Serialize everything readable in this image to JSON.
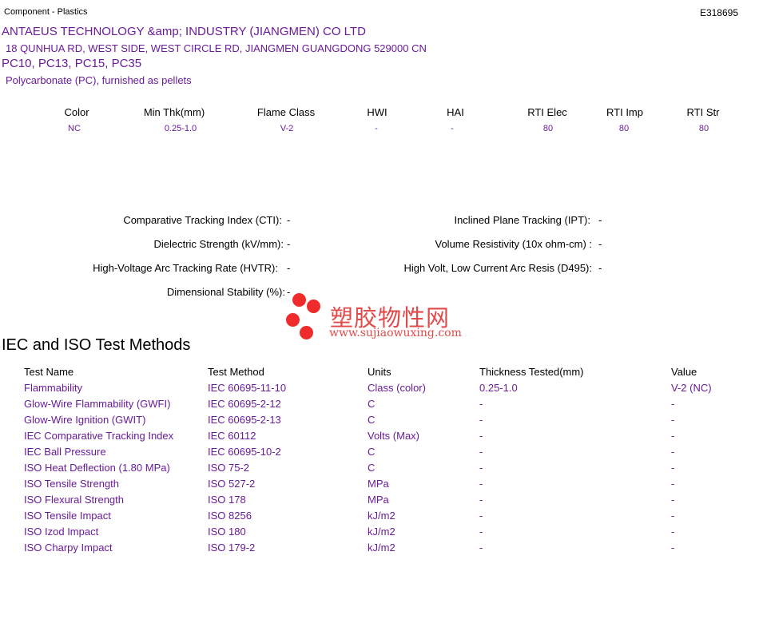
{
  "header": {
    "category": "Component - Plastics",
    "file_number": "E318695"
  },
  "company": {
    "name": "ANTAEUS TECHNOLOGY &amp; INDUSTRY (JIANGMEN) CO LTD",
    "address": "18 QUNHUA RD, WEST SIDE, WEST CIRCLE RD, JIANGMEN  GUANGDONG  529000 CN",
    "models": "PC10, PC13, PC15, PC35",
    "description": "Polycarbonate (PC), furnished as pellets"
  },
  "ratings": {
    "headers": [
      "Color",
      "Min Thk(mm)",
      "Flame Class",
      "HWI",
      "HAI",
      "RTI Elec",
      "RTI Imp",
      "RTI Str"
    ],
    "values": [
      "NC",
      "0.25-1.0",
      "V-2",
      "-",
      "-",
      "80",
      "80",
      "80"
    ]
  },
  "properties": {
    "cti_label": "Comparative Tracking Index (CTI):",
    "cti_value": "-",
    "ipt_label": "Inclined Plane Tracking (IPT):",
    "ipt_value": "-",
    "dielectric_label": "Dielectric Strength (kV/mm):",
    "dielectric_value": "-",
    "volume_label": "Volume Resistivity (10x ohm-cm) :",
    "volume_value": "-",
    "hvtr_label": "High-Voltage Arc Tracking Rate (HVTR):",
    "hvtr_value": "-",
    "d495_label": "High Volt, Low Current Arc Resis (D495):",
    "d495_value": "-",
    "dim_label": "Dimensional Stability (%):",
    "dim_value": "-"
  },
  "watermark": {
    "chinese": "塑胶物性网",
    "url": "www.sujiaowuxing.com",
    "color": "#e24a4a"
  },
  "iec_iso": {
    "title": "IEC and ISO Test Methods",
    "headers": [
      "Test Name",
      "Test Method",
      "Units",
      "Thickness Tested(mm)",
      "Value"
    ],
    "rows": [
      [
        "Flammability",
        "IEC 60695-11-10",
        "Class (color)",
        "0.25-1.0",
        "V-2 (NC)"
      ],
      [
        "Glow-Wire Flammability (GWFI)",
        "IEC 60695-2-12",
        "C",
        "-",
        "-"
      ],
      [
        "Glow-Wire Ignition (GWIT)",
        "IEC 60695-2-13",
        "C",
        "-",
        "-"
      ],
      [
        "IEC Comparative Tracking Index",
        "IEC 60112",
        "Volts (Max)",
        "-",
        "-"
      ],
      [
        "IEC Ball Pressure",
        "IEC 60695-10-2",
        "C",
        "-",
        "-"
      ],
      [
        "ISO Heat Deflection (1.80 MPa)",
        "ISO 75-2",
        "C",
        "-",
        "-"
      ],
      [
        "ISO Tensile Strength",
        "ISO 527-2",
        "MPa",
        "-",
        "-"
      ],
      [
        "ISO Flexural Strength",
        "ISO 178",
        "MPa",
        "-",
        "-"
      ],
      [
        "ISO Tensile Impact",
        "ISO 8256",
        "kJ/m2",
        "-",
        "-"
      ],
      [
        "ISO Izod Impact",
        "ISO 180",
        "kJ/m2",
        "-",
        "-"
      ],
      [
        "ISO Charpy Impact",
        "ISO 179-2",
        "kJ/m2",
        "-",
        "-"
      ]
    ]
  },
  "colors": {
    "accent": "#6a1b9a",
    "text": "#000000"
  }
}
